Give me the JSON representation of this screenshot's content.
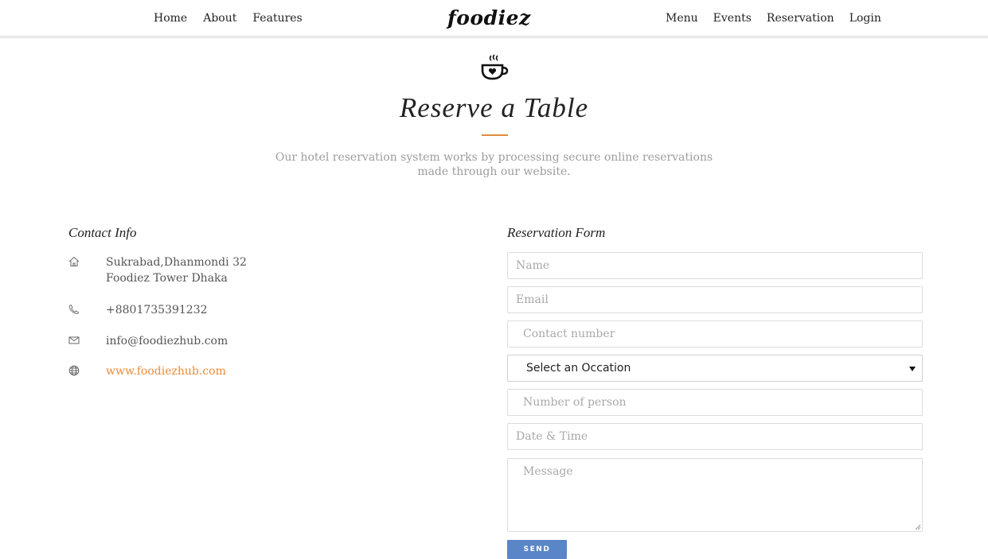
{
  "nav": {
    "left": [
      "Home",
      "About",
      "Features"
    ],
    "right": [
      "Menu",
      "Events",
      "Reservation",
      "Login"
    ],
    "brand": "foodiez"
  },
  "hero": {
    "icon": "coffee-cup-heart-icon",
    "title": "Reserve a Table",
    "subtitle_line1": "Our hotel reservation system works by processing secure online reservations",
    "subtitle_line2": "made through our website."
  },
  "contact": {
    "heading": "Contact Info",
    "address_line1": "Sukrabad,Dhanmondi 32",
    "address_line2": "Foodiez Tower Dhaka",
    "phone": "+8801735391232",
    "email": "info@foodiezhub.com",
    "website": "www.foodiezhub.com",
    "accent_color": "#ee8a35"
  },
  "form": {
    "heading": "Reservation Form",
    "name_placeholder": "Name",
    "email_placeholder": "Email",
    "contact_placeholder": "Contact number",
    "occasion_selected": "Select an Occation",
    "persons_placeholder": "Number of person",
    "datetime_placeholder": "Date & Time",
    "message_placeholder": "Message",
    "send_label": "SEND",
    "button_color": "#5a86c8"
  }
}
